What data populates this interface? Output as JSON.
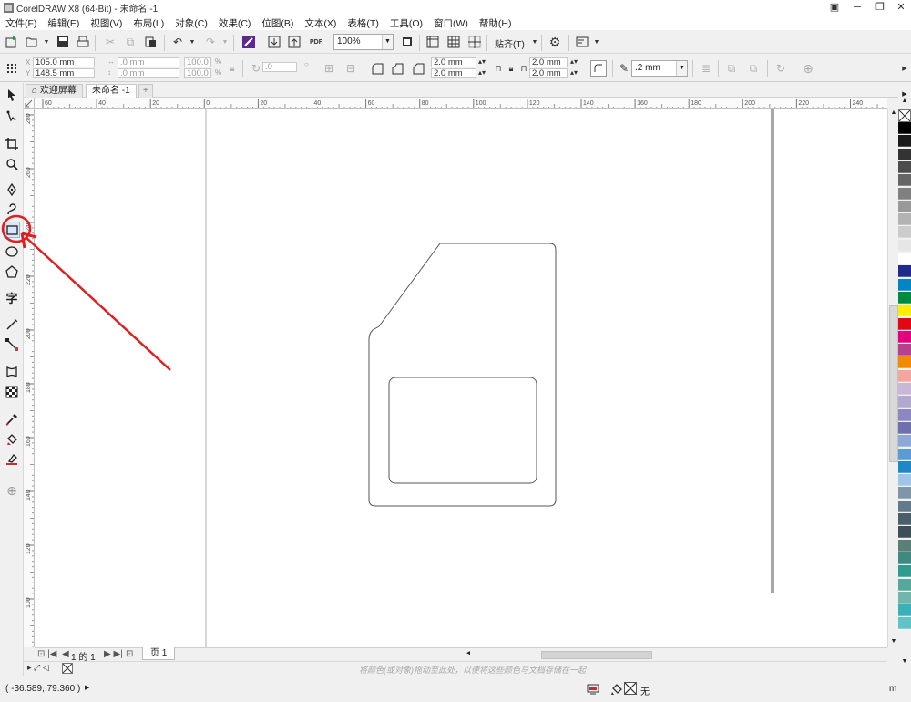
{
  "window": {
    "title": "CorelDRAW X8 (64-Bit) - 未命名 -1",
    "buttons": [
      "─",
      "❐",
      "✕"
    ]
  },
  "menu": [
    "文件(F)",
    "编辑(E)",
    "视图(V)",
    "布局(L)",
    "对象(C)",
    "效果(C)",
    "位图(B)",
    "文本(X)",
    "表格(T)",
    "工具(O)",
    "窗口(W)",
    "帮助(H)"
  ],
  "toolbar": {
    "zoom": "100%",
    "snap_label": "贴齐(T)",
    "pdf_label": "PDF"
  },
  "property_bar": {
    "x": "105.0 mm",
    "y": "148.5 mm",
    "width": ".0 mm",
    "height": ".0 mm",
    "scale_x": "100.0",
    "scale_y": "100.0",
    "percent": "%",
    "rotation": ".0",
    "corner_1": "2.0 mm",
    "corner_2": "2.0 mm",
    "corner_3": "2.0 mm",
    "corner_4": "2.0 mm",
    "outline_width": ".2 mm"
  },
  "tabs": [
    {
      "label": "欢迎屏幕"
    },
    {
      "label": "未命名 -1"
    }
  ],
  "ruler": {
    "horizontal_labels": [
      "60",
      "40",
      "20",
      "0",
      "20",
      "40",
      "60",
      "80",
      "100",
      "120",
      "140",
      "160",
      "180",
      "200",
      "220",
      "240"
    ],
    "vertical_labels": [
      "280",
      "260",
      "240",
      "220",
      "200",
      "180",
      "160",
      "140",
      "120",
      "100",
      "80",
      "60"
    ],
    "unit": "毫米"
  },
  "page_nav": {
    "page_counter": "1 的 1",
    "page_tab": "页 1"
  },
  "hint": "将颜色(或对象)拖动至此处，以便将这些颜色与文档存储在一起",
  "status": {
    "coords": "( -36.589, 79.360 )",
    "fill_label": "无",
    "unit_fragment": "m"
  },
  "palette": [
    "#000000",
    "#1a1a1a",
    "#333333",
    "#4d4d4d",
    "#666666",
    "#808080",
    "#999999",
    "#b3b3b3",
    "#cccccc",
    "#e6e6e6",
    "#ffffff",
    "#1e2a8c",
    "#0085c9",
    "#008a3e",
    "#ffed00",
    "#e30613",
    "#e6007e",
    "#b5418d",
    "#f08a00",
    "#f3a6a0",
    "#c9b7d8",
    "#b1a9d0",
    "#8c86c1",
    "#6f6fae",
    "#8ba9d4",
    "#5b9bd5",
    "#1f86c8",
    "#9fc5e8",
    "#7f96a6",
    "#627a8a",
    "#4a5f6b",
    "#3d4f58",
    "#5a7f78",
    "#3f8a80",
    "#2f9c8f",
    "#55a89b",
    "#6fb7aa",
    "#3cb0b8",
    "#5fc3c8"
  ],
  "colors": {
    "accent": "#e02020",
    "page_border": "#9a9a9a"
  }
}
